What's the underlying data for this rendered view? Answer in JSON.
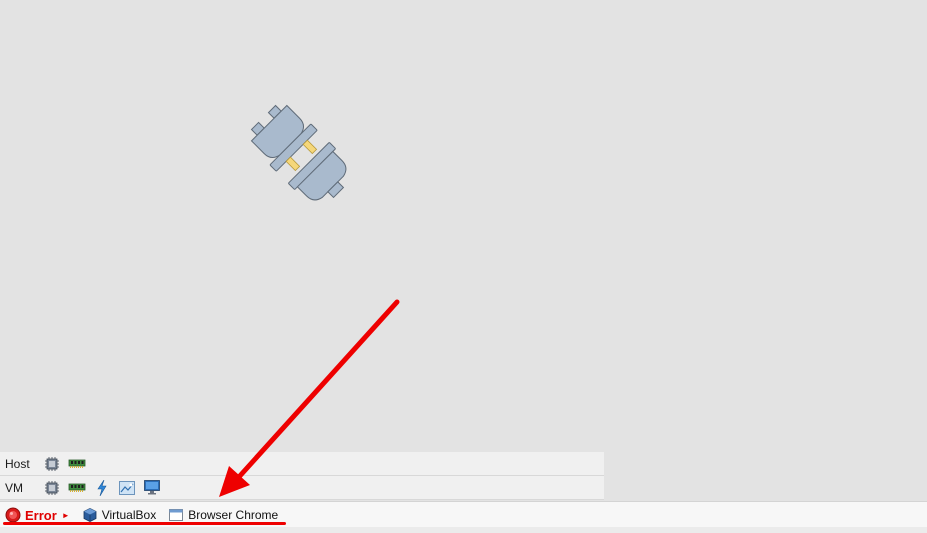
{
  "metrics": {
    "host": {
      "label": "Host",
      "icons": [
        "cpu-icon",
        "ram-icon"
      ]
    },
    "vm": {
      "label": "VM",
      "icons": [
        "cpu-icon",
        "ram-icon",
        "lightning-icon",
        "network-icon",
        "monitor-icon"
      ]
    }
  },
  "taskbar": {
    "error_label": "Error",
    "error_expand_glyph": "►",
    "virtualbox_label": "VirtualBox",
    "browser_label": "Browser Chrome"
  },
  "colors": {
    "background": "#e3e3e3",
    "plug_body": "#a9bacd",
    "plug_outline": "#5f6b78",
    "plug_pins": "#f5d77a",
    "error_red": "#e00000",
    "annotation_red": "#ee0000"
  },
  "illustration": {
    "icon": "disconnected-plug-icon"
  }
}
